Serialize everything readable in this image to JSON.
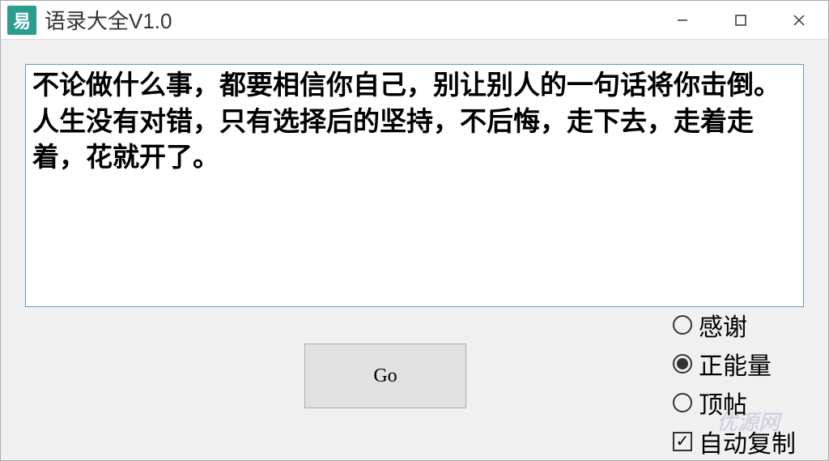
{
  "window": {
    "title": "语录大全V1.0",
    "icon_text": "易"
  },
  "quote": {
    "text": "不论做什么事，都要相信你自己，别让别人的一句话将你击倒。人生没有对错，只有选择后的坚持，不后悔，走下去，走着走着，花就开了。"
  },
  "button": {
    "go_label": "Go"
  },
  "options": {
    "radio": [
      {
        "label": "感谢",
        "selected": false
      },
      {
        "label": "正能量",
        "selected": true
      },
      {
        "label": "顶帖",
        "selected": false
      }
    ],
    "auto_copy_label": "自动复制",
    "auto_copy_checked": true
  },
  "watermark": "优源网"
}
